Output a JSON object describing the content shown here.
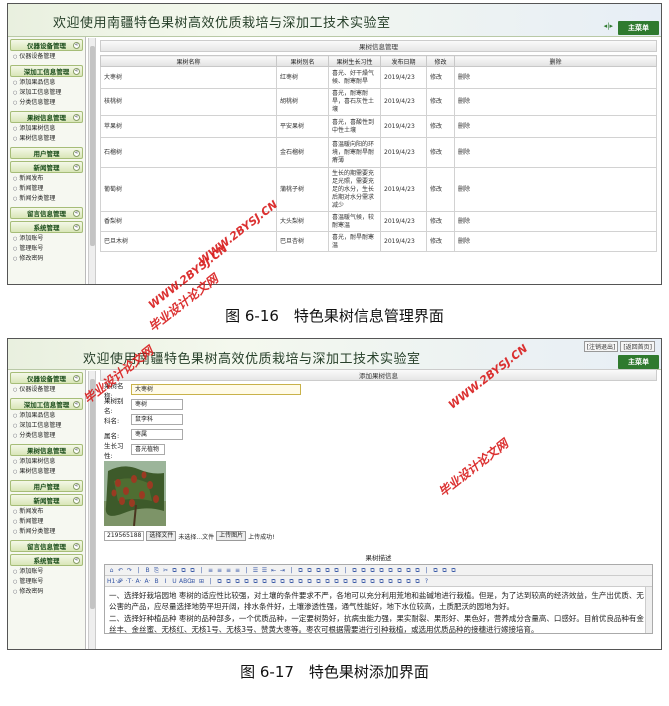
{
  "shot1": {
    "title": "欢迎使用南疆特色果树高效优质栽培与深加工技术实验室",
    "nav_arrows": "◂|▸",
    "main_menu": "主菜单",
    "section_header": "果树信息管理",
    "columns": [
      "果树名称",
      "果树别名",
      "果树生长习性",
      "发布日期",
      "修改",
      "删除"
    ],
    "rows": [
      [
        "大枣树",
        "红枣树",
        "喜光、好干燥气候、耐寒耐旱",
        "2019/4/23",
        "修改",
        "删除"
      ],
      [
        "核桃树",
        "胡桃树",
        "喜光，耐寒耐旱，喜石灰性土壤",
        "2019/4/23",
        "修改",
        "删除"
      ],
      [
        "苹果树",
        "平安果树",
        "喜光，喜酸性到中性土壤",
        "2019/4/23",
        "修改",
        "删除"
      ],
      [
        "石榴树",
        "金石榴树",
        "喜温暖向阳的环境，耐寒耐旱耐瘠薄",
        "2019/4/23",
        "修改",
        "删除"
      ],
      [
        "葡萄树",
        "蒲桃子树",
        "生长的期需要充足光照，需要充足的水分，生长后期对水分需求减少",
        "2019/4/23",
        "修改",
        "删除"
      ],
      [
        "香梨树",
        "大头梨树",
        "喜温暖气候，较耐寒温",
        "2019/4/23",
        "修改",
        "删除"
      ],
      [
        "巴旦木树",
        "巴旦杏树",
        "喜光，耐旱耐寒温",
        "2019/4/23",
        "修改",
        "删除"
      ]
    ]
  },
  "sidebar": [
    {
      "title": "仪器设备管理",
      "items": [
        "仪器设备管理"
      ]
    },
    {
      "title": "深加工信息管理",
      "items": [
        "添加果品信息",
        "深加工信息管理",
        "分类信息管理"
      ]
    },
    {
      "title": "果树信息管理",
      "items": [
        "添加果树信息",
        "果树信息管理"
      ]
    },
    {
      "title": "用户管理",
      "items": []
    },
    {
      "title": "新闻管理",
      "items": [
        "新闻发布",
        "新闻管理",
        "新闻分类管理"
      ]
    },
    {
      "title": "留言信息管理",
      "items": []
    },
    {
      "title": "系统管理",
      "items": [
        "添加账号",
        "管理账号",
        "修改密码"
      ]
    }
  ],
  "sidebar_toggle": "«",
  "caption1": "图 6-16　特色果树信息管理界面",
  "shot2": {
    "title": "欢迎使用南疆特色果树高效优质栽培与深加工技术实验室",
    "logout": "[注销退出]",
    "back_home": "[返回首页]",
    "main_menu": "主菜单",
    "section_header": "添加果树信息",
    "form": {
      "name_label": "果树名称:",
      "name_value": "大枣树",
      "alias_label": "果树别名:",
      "alias_value": "枣树",
      "family_label": "科名:",
      "family_value": "鼠李科",
      "genus_label": "属名:",
      "genus_value": "枣属",
      "habit_label": "生长习性:",
      "habit_value": "喜光植物"
    },
    "upload": {
      "filename": "219565188",
      "choose_label": "选择文件",
      "no_file": "未选择...文件",
      "upload_btn": "上传图片",
      "status": "上传成功!"
    },
    "editor_label": "果树描述",
    "toolbar_row1": [
      "⌂",
      "↶",
      "↷",
      "|",
      "B",
      "⎘",
      "✂",
      "⧉",
      "⧉",
      "⧉",
      "|",
      "≡",
      "≡",
      "≡",
      "≡",
      "|",
      "☰",
      "☰",
      "⇤",
      "⇥",
      "|",
      "⧉",
      "⧉",
      "⧉",
      "⧉",
      "⧉",
      "|",
      "⧉",
      "⧉",
      "⧉",
      "⧉",
      "⧉",
      "⧉",
      "⧉",
      "⧉",
      "|",
      "⧉",
      "⧉",
      "⧉"
    ],
    "toolbar_row2": [
      "H1·",
      "𝓕·",
      "·T·",
      "A·",
      "A·",
      "B",
      "I",
      "U",
      "ABC",
      "⊞",
      "⊞",
      "|",
      "⧉",
      "⧉",
      "⧉",
      "⧉",
      "⧉",
      "⧉",
      "⧉",
      "⧉",
      "⧉",
      "⧉",
      "⧉",
      "⧉",
      "⧉",
      "⧉",
      "⧉",
      "⧉",
      "⧉",
      "⧉",
      "⧉",
      "⧉",
      "⧉",
      "⧉",
      "⧉",
      "?"
    ],
    "description": [
      "一、选择好栽培园地 枣树的适应性比较强，对土壤的条件要求不严，各地可以充分利用荒地和盐碱地进行栽植。但是，为了达到较高的经济效益，生产出优质、无公害的产品，应尽量选择地势平坦开阔，排水条件好，土壤渗透性强，通气性能好，地下水位较高，土质肥沃的园地为好。",
      "二、选择好种植品种 枣树的品种部多，一个优质品种，一定要树势好，抗病虫能力强，果实耐裂、果形好、果色好，营养成分含量高、口感好。目前优良品种有金丝丰、金丝蜜、无核红、无核1号、无核3号、赞黄大枣等。枣农可根据需要进行引种栽植，或选用优质品种的接穗进行嫁接培育。"
    ]
  },
  "caption2": "图 6-17　特色果树添加界面",
  "watermarks": [
    "毕业设计论文网",
    "WWW.2BYSJ.CN",
    "毕业设计论文网",
    "WWW.2BYSJ.CN",
    "毕业设计论文网",
    "WWW.2BYSJ.CN"
  ],
  "colors": {
    "watermark": "#d92020",
    "menu_green": "#2f7a2f",
    "sidebar_group_border": "#a6bd78"
  }
}
